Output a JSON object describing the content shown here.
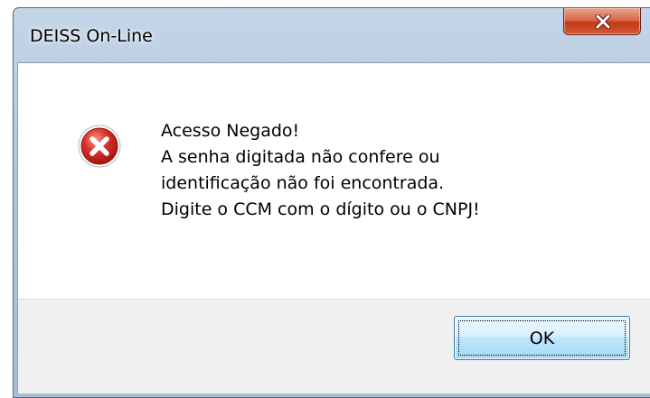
{
  "window": {
    "title": "DEISS On-Line"
  },
  "message": {
    "icon": "error-icon",
    "lines": [
      "Acesso Negado!",
      "A senha digitada não confere ou",
      "identificação não foi encontrada.",
      "Digite o CCM com o dígito ou o CNPJ!"
    ]
  },
  "buttons": {
    "ok_label": "OK",
    "close_icon": "close-icon"
  },
  "colors": {
    "error_red": "#c8281e",
    "close_button": "#c43a18",
    "button_border": "#3c7fb1"
  }
}
